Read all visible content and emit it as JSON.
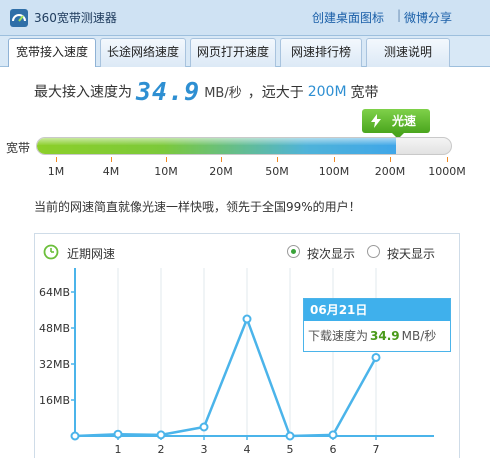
{
  "window": {
    "title": "360宽带测速器",
    "link_desktop": "创建桌面图标",
    "link_separator": "|",
    "link_weibo": "微博分享"
  },
  "tabs": [
    {
      "label": "宽带接入速度",
      "active": true
    },
    {
      "label": "长途网络速度",
      "active": false
    },
    {
      "label": "网页打开速度",
      "active": false
    },
    {
      "label": "网速排行榜",
      "active": false
    },
    {
      "label": "测速说明",
      "active": false
    }
  ],
  "result": {
    "prefix": "最大接入速度为",
    "value": "34.9",
    "unit": "MB/秒",
    "mid": "，远大于",
    "band": "200M",
    "suffix": "宽带"
  },
  "badge": {
    "label": "光速"
  },
  "speed_bar": {
    "label": "宽带",
    "fill_fraction": 0.864,
    "scale": [
      "1M",
      "4M",
      "10M",
      "20M",
      "50M",
      "100M",
      "200M",
      "1000M"
    ]
  },
  "message": "当前的网速简直就像光速一样快哦，领先于全国99%的用户！",
  "chart_panel": {
    "title": "近期网速",
    "options": [
      {
        "label": "按次显示",
        "checked": true
      },
      {
        "label": "按天显示",
        "checked": false
      }
    ]
  },
  "chart_data": {
    "type": "line",
    "x": [
      0,
      1,
      2,
      3,
      4,
      5,
      6,
      7
    ],
    "x_tick_labels": [
      "1",
      "2",
      "3",
      "4",
      "5",
      "6",
      "7"
    ],
    "values": [
      0,
      0.8,
      0.5,
      4,
      52,
      0,
      0.5,
      34.9
    ],
    "ylim": [
      0,
      72
    ],
    "y_ticks": [
      16,
      32,
      48,
      64
    ],
    "y_tick_labels": [
      "16MB",
      "32MB",
      "48MB",
      "64MB"
    ],
    "grid": true,
    "color": "#4bb4ea"
  },
  "tooltip": {
    "date": "06月21日",
    "label": "下载速度为",
    "value": "34.9",
    "unit": "MB/秒"
  },
  "colors": {
    "accent": "#2e8fd2",
    "badge_green": "#4aa51d",
    "line_blue": "#4bb4ea",
    "grid_gray": "#e2e8ee"
  }
}
